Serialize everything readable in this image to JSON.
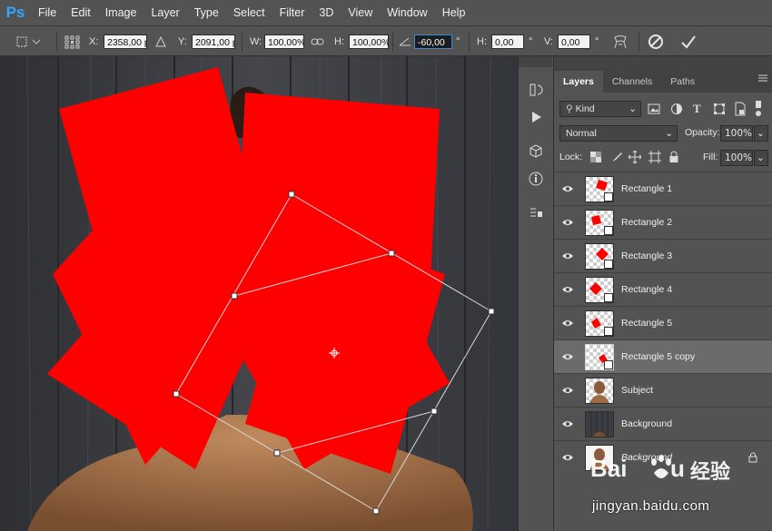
{
  "app": {
    "logo": "Ps"
  },
  "menu": [
    "File",
    "Edit",
    "Image",
    "Layer",
    "Type",
    "Select",
    "Filter",
    "3D",
    "View",
    "Window",
    "Help"
  ],
  "options": {
    "x_label": "X:",
    "x_value": "2358,00 px",
    "y_label": "Y:",
    "y_value": "2091,00 px",
    "w_label": "W:",
    "w_value": "100,00%",
    "h_label": "H:",
    "h_value": "100,00%",
    "angle_value": "-60,00",
    "angle_unit": "°",
    "hskew_label": "H:",
    "hskew_value": "0,00",
    "hskew_unit": "°",
    "vskew_label": "V:",
    "vskew_value": "0,00",
    "vskew_unit": "°"
  },
  "panel": {
    "tabs": [
      "Layers",
      "Channels",
      "Paths"
    ],
    "filter_kind": "Kind",
    "blend_mode": "Normal",
    "opacity_label": "Opacity:",
    "opacity_value": "100%",
    "lock_label": "Lock:",
    "fill_label": "Fill:",
    "fill_value": "100%"
  },
  "layers": [
    {
      "name": "Rectangle 1",
      "thumb": "rect",
      "selected": false
    },
    {
      "name": "Rectangle 2",
      "thumb": "rect",
      "selected": false
    },
    {
      "name": "Rectangle 3",
      "thumb": "diamond",
      "selected": false
    },
    {
      "name": "Rectangle 4",
      "thumb": "diamond",
      "selected": false
    },
    {
      "name": "Rectangle 5",
      "thumb": "rect",
      "selected": false
    },
    {
      "name": "Rectangle 5 copy",
      "thumb": "rect",
      "selected": true
    },
    {
      "name": "Subject",
      "thumb": "person",
      "selected": false
    },
    {
      "name": "Background",
      "thumb": "wood",
      "selected": false
    },
    {
      "name": "Background",
      "thumb": "person",
      "selected": false,
      "italic": true,
      "locked": true
    }
  ],
  "watermark": {
    "text": "jingyan.baidu.com"
  },
  "colors": {
    "accent": "#31a8ff",
    "shape_fill": "#ff0000",
    "panel_bg": "#535353",
    "selected_row": "#6b6b6b"
  }
}
